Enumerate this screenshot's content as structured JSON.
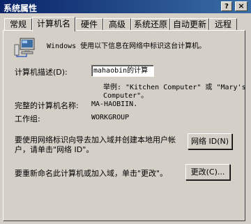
{
  "window": {
    "title": "系统属性",
    "help_label": "?",
    "close_label": "×"
  },
  "tabs": [
    {
      "label": "常规"
    },
    {
      "label": "计算机名"
    },
    {
      "label": "硬件"
    },
    {
      "label": "高级"
    },
    {
      "label": "系统还原"
    },
    {
      "label": "自动更新"
    },
    {
      "label": "远程"
    }
  ],
  "info": {
    "text": "Windows 使用以下信息在网络中标识这台计算机。"
  },
  "description": {
    "label": "计算机描述(D):",
    "value": "mahaobin的计算机",
    "example_line1": "举例: \"Kitchen Computer\" 或 \"Mary's",
    "example_line2": "Computer\"。"
  },
  "full_name": {
    "label": "完整的计算机名称:",
    "value": "MA-HAOBIIN."
  },
  "workgroup": {
    "label": "工作组:",
    "value": "WORKGROUP"
  },
  "network_id": {
    "text_line1": "要使用网络标识向导去加入域并创建本地用户帐",
    "text_line2": "户，请单击\"网络 ID\"。",
    "button_label": "网络 ID(N)"
  },
  "change": {
    "text": "要重新命名此计算机或加入域，单击\"更改\"。",
    "button_label": "更改(C)..."
  }
}
